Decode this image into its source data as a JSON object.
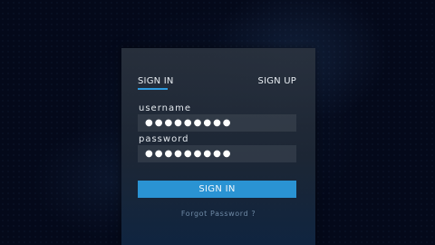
{
  "tabs": {
    "signin_label": "SIGN IN",
    "signup_label": "SIGN UP",
    "active": "signin"
  },
  "form": {
    "username_label": "username",
    "username_value": "●●●●●●●●●",
    "password_label": "password",
    "password_value": "●●●●●●●●●",
    "submit_label": "SIGN IN",
    "forgot_label": "Forgot Password ?"
  },
  "colors": {
    "accent": "#2a93d3",
    "background": "#04091a"
  }
}
